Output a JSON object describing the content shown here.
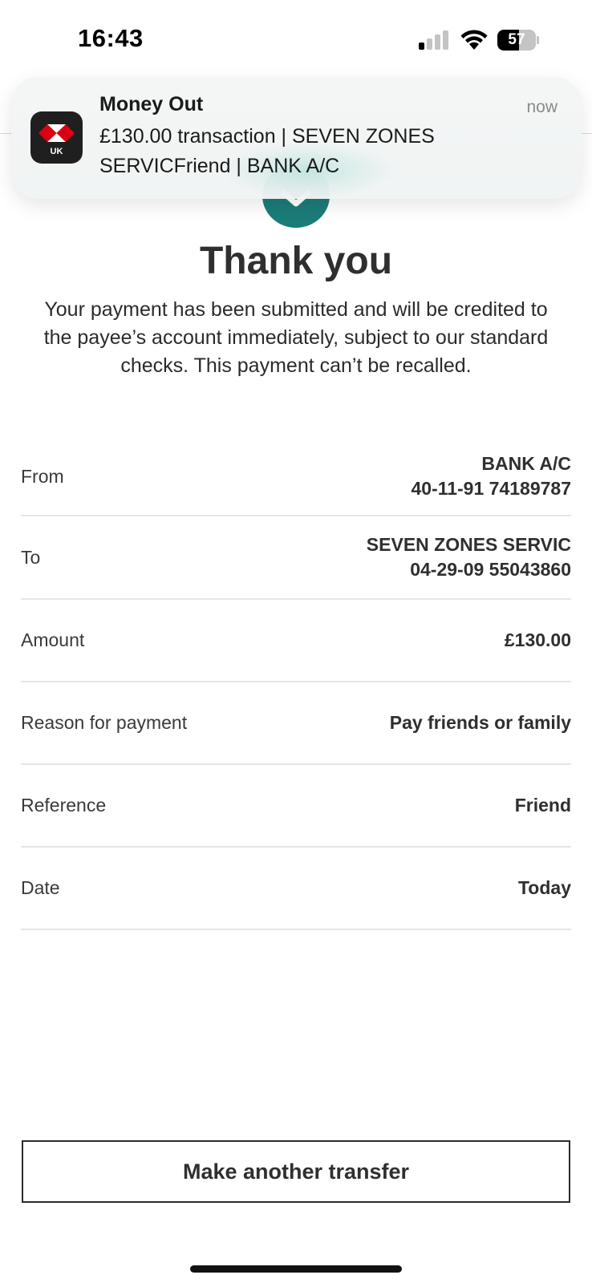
{
  "status_bar": {
    "time": "16:43",
    "battery": "57",
    "battery_level": 0.57,
    "signal_bars_active": 1
  },
  "notification": {
    "app_icon": "hsbc-uk-app-icon",
    "app_icon_label": "UK",
    "title": "Money Out",
    "time": "now",
    "body": "£130.00 transaction | SEVEN ZONES SERVICFriend | BANK A/C"
  },
  "confirmation": {
    "icon": "checkmark-icon",
    "title": "Thank you",
    "message": "Your payment has been submitted and will be credited to the payee’s account immediately, subject to our standard checks. This payment can’t be recalled."
  },
  "details": {
    "from": {
      "label": "From",
      "value_line1": "BANK A/C",
      "value_line2": "40-11-91 74189787"
    },
    "to": {
      "label": "To",
      "value_line1": "SEVEN ZONES SERVIC",
      "value_line2": "04-29-09 55043860"
    },
    "amount": {
      "label": "Amount",
      "value": "£130.00"
    },
    "reason": {
      "label": "Reason for payment",
      "value": "Pay friends or family"
    },
    "reference": {
      "label": "Reference",
      "value": "Friend"
    },
    "date": {
      "label": "Date",
      "value": "Today"
    }
  },
  "actions": {
    "make_another_transfer": "Make another transfer"
  },
  "colors": {
    "accent": "#1b7c78",
    "text": "#2f2f2f",
    "divider": "#e6e6e6"
  }
}
